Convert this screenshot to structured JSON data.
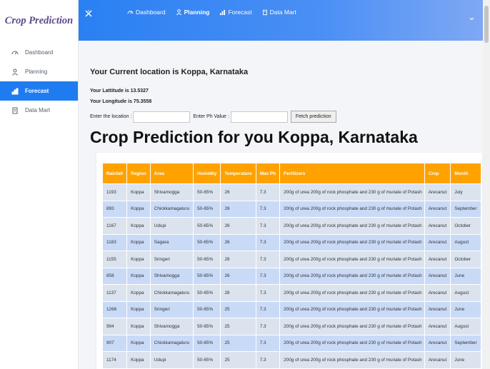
{
  "sidebar": {
    "brand": "Crop Prediction",
    "items": [
      {
        "label": "Dashboard",
        "icon": "dashboard-icon"
      },
      {
        "label": "Planning",
        "icon": "person-icon"
      },
      {
        "label": "Forecast",
        "icon": "bar-chart-icon",
        "active": true
      },
      {
        "label": "Data Mart",
        "icon": "document-icon"
      }
    ]
  },
  "topbar": {
    "items": [
      {
        "label": "Dashboard",
        "icon": "dashboard-icon"
      },
      {
        "label": "Planning",
        "icon": "person-icon"
      },
      {
        "label": "Forecast",
        "icon": "bar-chart-icon"
      },
      {
        "label": "Data Mart",
        "icon": "document-icon"
      }
    ]
  },
  "location": {
    "heading": "Your Current location is Koppa, Karnataka",
    "latitude": "Your Lattitude is 13.5327",
    "longitude": "Your Longitude is 75.3558"
  },
  "form": {
    "location_label": "Enter the location :",
    "ph_label": "Enter Ph Value :",
    "fetch_button": "Fetch prediction"
  },
  "title": "Crop Prediction for you Koppa, Karnataka",
  "table": {
    "headers": [
      "Rainfall",
      "Region",
      "Area",
      "Humidity",
      "Temperature",
      "Max Ph",
      "Fertilizers",
      "Crop",
      "Month"
    ],
    "rows": [
      [
        "1193",
        "Koppa",
        "Shivamogga",
        "50-65%",
        "26",
        "7.3",
        "200g of urea 200g of rock phosphate and 230 g of muriate of Potash",
        "Arecanut",
        "July"
      ],
      [
        "893",
        "Koppa",
        "Chickkamagaluru",
        "50-65%",
        "26",
        "7.3",
        "200g of urea 200g of rock phosphate and 230 g of muriate of Potash",
        "Arecanut",
        "September"
      ],
      [
        "1167",
        "Koppa",
        "Udupi",
        "50-65%",
        "26",
        "7.3",
        "200g of urea 200g of rock phosphate and 230 g of muriate of Potash",
        "Arecanut",
        "October"
      ],
      [
        "1183",
        "Koppa",
        "Sagara",
        "50-65%",
        "26",
        "7.3",
        "200g of urea 200g of rock phosphate and 230 g of muriate of Potash",
        "Arecanut",
        "August"
      ],
      [
        "1155",
        "Koppa",
        "Sringeri",
        "50-65%",
        "26",
        "7.3",
        "200g of urea 200g of rock phosphate and 230 g of muriate of Potash",
        "Arecanut",
        "October"
      ],
      [
        "858",
        "Koppa",
        "Shivamogga",
        "50-65%",
        "26",
        "7.3",
        "200g of urea 200g of rock phosphate and 230 g of muriate of Potash",
        "Arecanut",
        "June"
      ],
      [
        "1137",
        "Koppa",
        "Chickkamagaluru",
        "50-65%",
        "26",
        "7.3",
        "200g of urea 200g of rock phosphate and 230 g of muriate of Potash",
        "Arecanut",
        "August"
      ],
      [
        "1266",
        "Koppa",
        "Sringeri",
        "50-65%",
        "25",
        "7.3",
        "200g of urea 200g of rock phosphate and 230 g of muriate of Potash",
        "Arecanut",
        "June"
      ],
      [
        "994",
        "Koppa",
        "Shivamogga",
        "50-65%",
        "25",
        "7.3",
        "200g of urea 200g of rock phosphate and 230 g of muriate of Potash",
        "Arecanut",
        "August"
      ],
      [
        "907",
        "Koppa",
        "Chickkamagaluru",
        "50-65%",
        "25",
        "7.3",
        "200g of urea 200g of rock phosphate and 230 g of muriate of Potash",
        "Arecanut",
        "September"
      ],
      [
        "1174",
        "Koppa",
        "Udupi",
        "50-65%",
        "25",
        "7.3",
        "200g of urea 200g of rock phosphate and 230 g of muriate of Potash",
        "Arecanut",
        "June"
      ]
    ]
  },
  "colors": {
    "accent": "#1f7cf0",
    "header_orange": "#ffa200",
    "brand_purple": "#5c4a8a"
  }
}
